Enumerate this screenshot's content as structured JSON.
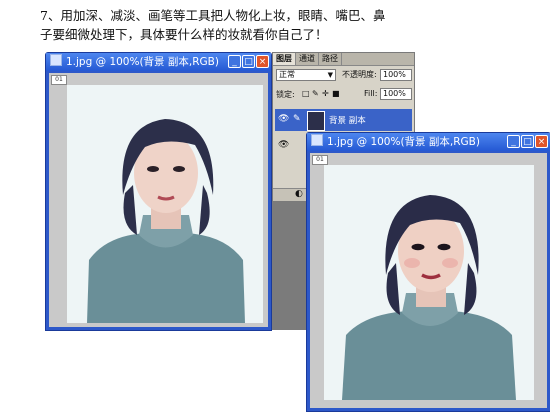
{
  "instruction": {
    "line1": "7、用加深、减淡、画笔等工具把人物化上妆，眼睛、嘴巴、鼻",
    "line2": "子要细微处理下，具体要什么样的妆就看你自己了！"
  },
  "window_back": {
    "title": "1.jpg @ 100%(背景 副本,RGB)",
    "minimize": "_",
    "maximize": "□",
    "close": "×",
    "ruler_tag": "01"
  },
  "window_front": {
    "title": "1.jpg @ 100%(背景 副本,RGB)",
    "minimize": "_",
    "maximize": "□",
    "close": "×",
    "ruler_tag": "01"
  },
  "layers_panel": {
    "tabs": [
      "图层",
      "通道",
      "路径"
    ],
    "blend_mode": "正常",
    "opacity_label": "不透明度:",
    "opacity_value": "100%",
    "lock_label": "锁定:",
    "fill_label": "Fill:",
    "fill_value": "100%",
    "layer_name": "背景 副本"
  },
  "colors": {
    "titlebar": "#2458d3",
    "close_button": "#e0552b",
    "layer_selected": "#3a63c8"
  }
}
